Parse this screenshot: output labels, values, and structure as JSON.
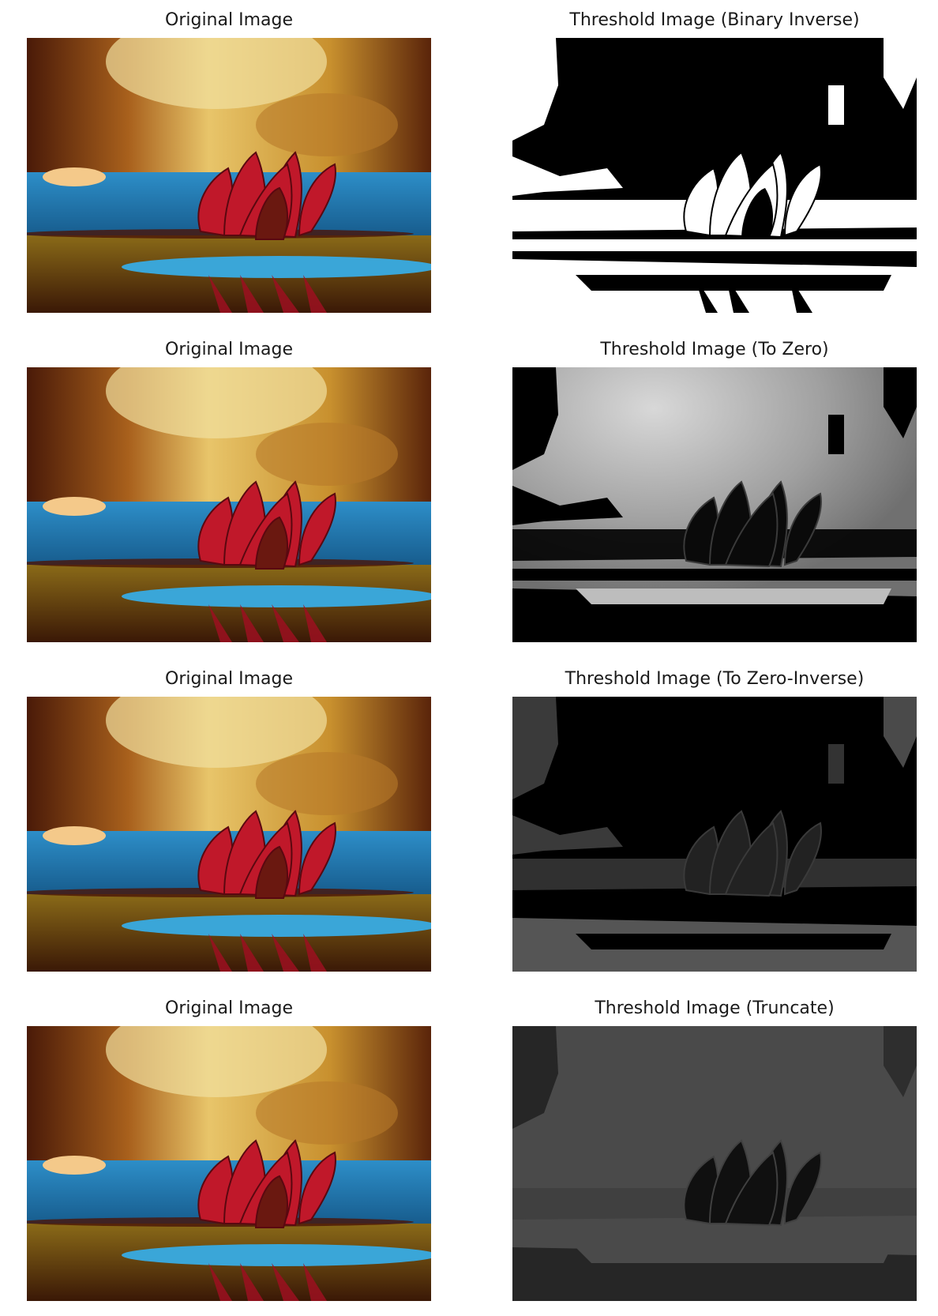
{
  "panels": [
    {
      "title": "Original Image",
      "kind": "original"
    },
    {
      "title": "Threshold Image (Binary Inverse)",
      "kind": "binary_inverse"
    },
    {
      "title": "Original Image",
      "kind": "original"
    },
    {
      "title": "Threshold Image (To Zero)",
      "kind": "to_zero"
    },
    {
      "title": "Original Image",
      "kind": "original"
    },
    {
      "title": "Threshold Image (To Zero-Inverse)",
      "kind": "to_zero_inverse"
    },
    {
      "title": "Original Image",
      "kind": "original"
    },
    {
      "title": "Threshold Image (Truncate)",
      "kind": "truncate"
    }
  ]
}
